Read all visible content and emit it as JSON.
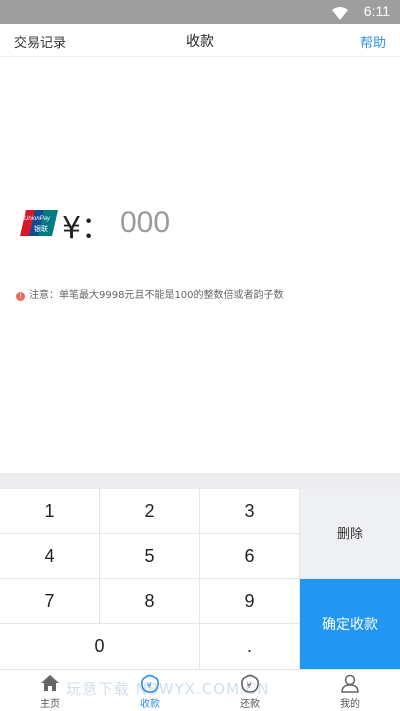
{
  "status_bar": {
    "time": "6:11",
    "icon": "wifi-icon"
  },
  "nav": {
    "left": "交易记录",
    "title": "收款",
    "right": "帮助"
  },
  "amount": {
    "currency_label": "¥：",
    "placeholder": "000",
    "brand_icon": "unionpay-logo"
  },
  "notice": {
    "text": "注意：单笔最大9998元且不能是100的整数倍或者韵子数",
    "icon": "exclamation-icon"
  },
  "keypad": {
    "keys": [
      "1",
      "2",
      "3",
      "4",
      "5",
      "6",
      "7",
      "8",
      "9",
      "0",
      "."
    ],
    "delete_label": "删除",
    "confirm_label": "确定收款"
  },
  "tabs": [
    {
      "label": "主页",
      "icon": "home-icon"
    },
    {
      "label": "收款",
      "icon": "receive-icon",
      "active": true
    },
    {
      "label": "还款",
      "icon": "repay-icon"
    },
    {
      "label": "我的",
      "icon": "user-icon"
    }
  ],
  "watermark": "玩意下载 NBWYX.COM.CN",
  "colors": {
    "accent": "#2196f3",
    "link": "#2a93e8",
    "status_bar": "#9e9e9e",
    "notice_dot": "#e96c5b"
  }
}
